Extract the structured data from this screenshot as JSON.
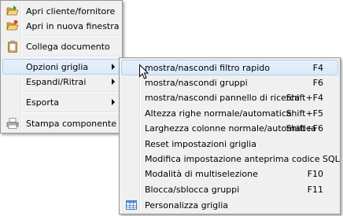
{
  "main_menu": {
    "items": [
      {
        "label": "Apri cliente/fornitore",
        "icon": "open-folder-icon"
      },
      {
        "label": "Apri in nuova finestra",
        "icon": "open-folder-new-icon"
      },
      {
        "label": "Collega documento",
        "icon": "clipboard-icon"
      },
      {
        "label": "Opzioni griglia",
        "has_submenu": true,
        "state": "highlighted"
      },
      {
        "label": "Espandi/Ritrai",
        "has_submenu": true
      },
      {
        "label": "Esporta",
        "has_submenu": true
      },
      {
        "label": "Stampa componente",
        "icon": "printer-icon"
      }
    ]
  },
  "submenu": {
    "items": [
      {
        "label": "mostra/nascondi filtro rapido",
        "shortcut": "F4",
        "state": "highlighted"
      },
      {
        "label": "mostra/nascondi gruppi",
        "shortcut": "F6"
      },
      {
        "label": "mostra/nascondi pannello di ricerca",
        "shortcut": "Shift+F4"
      },
      {
        "label": "Altezza righe normale/automatica",
        "shortcut": "Shift+F5"
      },
      {
        "label": "Larghezza colonne normale/automatica",
        "shortcut": "Shift+F6"
      },
      {
        "label": "Reset impostazioni griglia",
        "shortcut": ""
      },
      {
        "label": "Modifica impostazione anteprima codice SQL",
        "shortcut": ""
      },
      {
        "label": "Modalità di multiselezione",
        "shortcut": "F10"
      },
      {
        "label": "Blocca/sblocca gruppi",
        "shortcut": "F11"
      },
      {
        "label": "Personalizza griglia",
        "shortcut": "",
        "icon": "grid-icon"
      }
    ]
  },
  "colors": {
    "menu_bg": "#f0f0f0",
    "menu_border": "#979797",
    "highlight_border": "#aecff7",
    "highlight_bg": "#dce9f7"
  }
}
